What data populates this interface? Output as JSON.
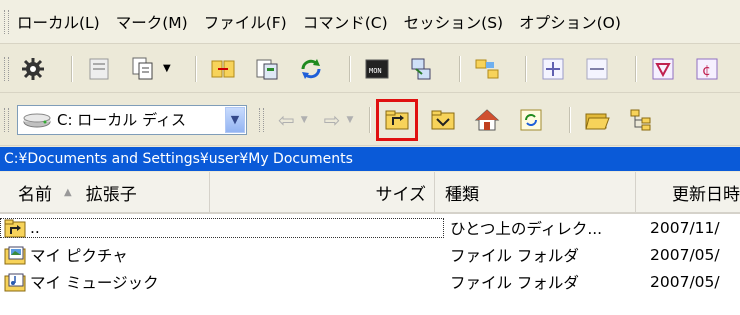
{
  "menu": [
    "ローカル(L)",
    "マーク(M)",
    "ファイル(F)",
    "コマンド(C)",
    "セッション(S)",
    "オプション(O)"
  ],
  "drive": {
    "label": "C: ローカル ディス"
  },
  "path": "C:¥Documents and Settings¥user¥My Documents",
  "columns": {
    "name": "名前",
    "ext": "拡張子",
    "size": "サイズ",
    "type": "種類",
    "date": "更新日時"
  },
  "rows": [
    {
      "name": "..",
      "type": "ひとつ上のディレク...",
      "date": "2007/11/",
      "icon": "folder-up-icon"
    },
    {
      "name": "マイ ピクチャ",
      "type": "ファイル フォルダ",
      "date": "2007/05/",
      "icon": "pictures-folder-icon"
    },
    {
      "name": "マイ ミュージック",
      "type": "ファイル フォルダ",
      "date": "2007/05/",
      "icon": "music-folder-icon"
    }
  ],
  "colors": {
    "path_bar": "#0a5ad8",
    "highlight": "#e01010"
  }
}
